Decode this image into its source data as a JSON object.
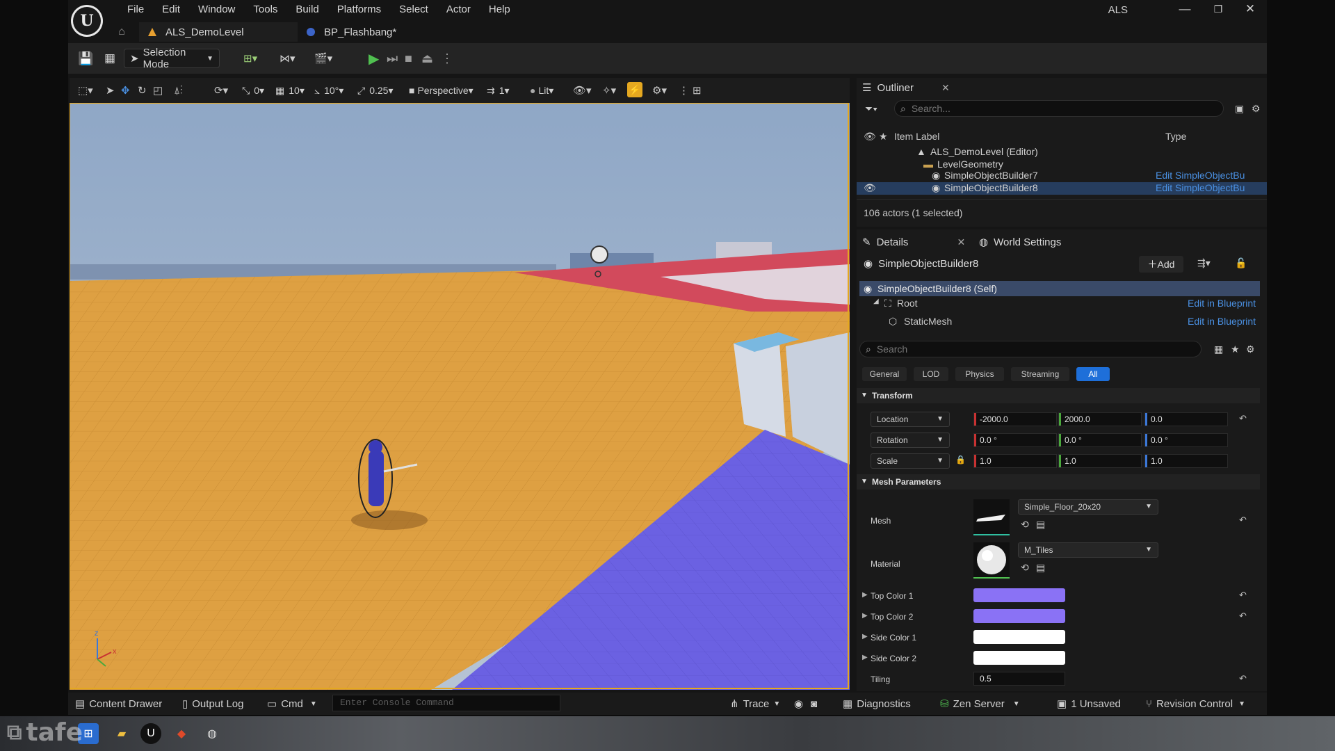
{
  "app": {
    "project_name": "ALS",
    "menu": [
      "File",
      "Edit",
      "Window",
      "Tools",
      "Build",
      "Platforms",
      "Select",
      "Actor",
      "Help"
    ],
    "tabs": [
      {
        "label": "ALS_DemoLevel",
        "active": true
      },
      {
        "label": "BP_Flashbang*",
        "active": false
      }
    ],
    "window_buttons": {
      "minimize": "—",
      "maximize": "❐",
      "close": "✕"
    }
  },
  "toolbar": {
    "selection_mode": "Selection Mode"
  },
  "viewport": {
    "rotate_snap": "0",
    "grid_snap": "10",
    "angle_snap": "10°",
    "scale_snap": "0.25",
    "view_mode": "Perspective",
    "cam_speed": "1",
    "lighting": "Lit",
    "axis_x": "x",
    "axis_z": "z"
  },
  "outliner": {
    "title": "Outliner",
    "search_placeholder": "Search...",
    "col_label": "Item Label",
    "col_type": "Type",
    "rows": [
      {
        "label": "ALS_DemoLevel (Editor)",
        "type": ""
      },
      {
        "label": "LevelGeometry",
        "type": ""
      },
      {
        "label": "SimpleObjectBuilder7",
        "type": "Edit SimpleObjectBu"
      },
      {
        "label": "SimpleObjectBuilder8",
        "type": "Edit SimpleObjectBu"
      }
    ],
    "status": "106 actors (1 selected)"
  },
  "details": {
    "tab_details": "Details",
    "tab_world": "World Settings",
    "actor_name": "SimpleObjectBuilder8",
    "add_label": "Add",
    "self_label": "SimpleObjectBuilder8 (Self)",
    "components": [
      {
        "name": "Root",
        "link": "Edit in Blueprint"
      },
      {
        "name": "StaticMesh",
        "link": "Edit in Blueprint"
      }
    ],
    "search_placeholder": "Search",
    "filters": [
      "General",
      "LOD",
      "Physics",
      "Streaming",
      "All"
    ],
    "active_filter": "All",
    "transform": {
      "header": "Transform",
      "location_label": "Location",
      "location": [
        "-2000.0",
        "2000.0",
        "0.0"
      ],
      "rotation_label": "Rotation",
      "rotation": [
        "0.0 °",
        "0.0 °",
        "0.0 °"
      ],
      "scale_label": "Scale",
      "scale": [
        "1.0",
        "1.0",
        "1.0"
      ]
    },
    "mesh_params": {
      "header": "Mesh Parameters",
      "mesh_label": "Mesh",
      "mesh_value": "Simple_Floor_20x20",
      "material_label": "Material",
      "material_value": "M_Tiles",
      "colors": [
        {
          "label": "Top Color 1",
          "color": "#8a72f5"
        },
        {
          "label": "Top Color 2",
          "color": "#8a72f5"
        },
        {
          "label": "Side Color 1",
          "color": "#ffffff"
        },
        {
          "label": "Side Color 2",
          "color": "#ffffff"
        }
      ],
      "tiling_label": "Tiling",
      "tiling_value": "0.5"
    }
  },
  "bottom_bar": {
    "content_drawer": "Content Drawer",
    "output_log": "Output Log",
    "cmd": "Cmd",
    "console_placeholder": "Enter Console Command",
    "trace": "Trace",
    "diagnostics": "Diagnostics",
    "zen_server": "Zen Server",
    "unsaved": "1 Unsaved",
    "revision_control": "Revision Control"
  },
  "watermark": "tafe",
  "colors": {
    "accent": "#1e6fd9",
    "floor_orange": "#e0a040",
    "floor_blue": "#6a5fe0",
    "sky": "#9fb0c6"
  }
}
